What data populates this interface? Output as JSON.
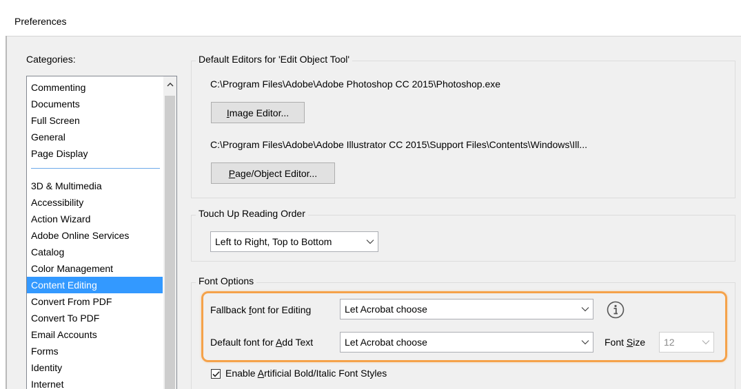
{
  "window": {
    "title": "Preferences"
  },
  "categories": {
    "label": "Categories:",
    "group_top": [
      "Commenting",
      "Documents",
      "Full Screen",
      "General",
      "Page Display"
    ],
    "group_bottom": [
      "3D & Multimedia",
      "Accessibility",
      "Action Wizard",
      "Adobe Online Services",
      "Catalog",
      "Color Management",
      "Content Editing",
      "Convert From PDF",
      "Convert To PDF",
      "Email Accounts",
      "Forms",
      "Identity",
      "Internet"
    ],
    "selected": "Content Editing"
  },
  "default_editors": {
    "title": "Default Editors for 'Edit Object Tool'",
    "image_path": "C:\\Program Files\\Adobe\\Adobe Photoshop CC 2015\\Photoshop.exe",
    "image_editor_button": "Image Editor...",
    "page_path": "C:\\Program Files\\Adobe\\Adobe Illustrator CC 2015\\Support Files\\Contents\\Windows\\Ill...",
    "page_editor_button": "Page/Object Editor..."
  },
  "touch_up": {
    "title": "Touch Up Reading Order",
    "selected": "Left to Right, Top to Bottom"
  },
  "font_options": {
    "title": "Font Options",
    "fallback_label": "Fallback font for Editing",
    "fallback_value": "Let Acrobat choose",
    "default_label": "Default font for Add Text",
    "default_value": "Let Acrobat choose",
    "font_size_label": "Font Size",
    "font_size_value": "12",
    "enable_styles_label": "Enable Artificial Bold/Italic Font Styles",
    "enable_styles_checked": true
  },
  "icons": {
    "info": "info-icon",
    "dropdown": "chevron-down-icon",
    "scroll_up": "chevron-up-icon",
    "checkbox": "check-icon"
  },
  "colors": {
    "selection": "#3399ff",
    "highlight": "#f5a24a",
    "dialog_bg": "#f0f0f0"
  }
}
